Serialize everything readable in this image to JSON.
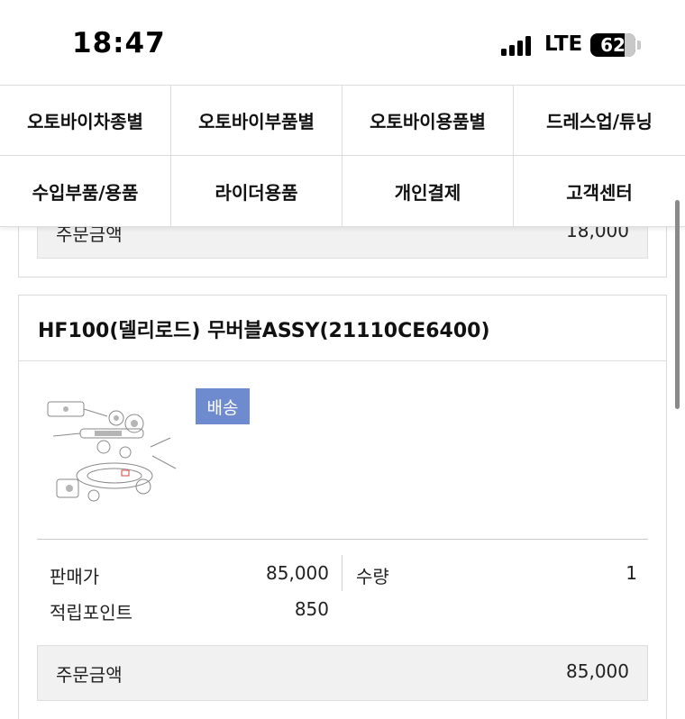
{
  "status_bar": {
    "time": "18:47",
    "network": "LTE",
    "battery": "62"
  },
  "menu": {
    "items": [
      "오토바이차종별",
      "오토바이부품별",
      "오토바이용품별",
      "드레스업/튜닝",
      "수입부품/용품",
      "라이더용품",
      "개인결제",
      "고객센터"
    ]
  },
  "prev_item": {
    "total_label": "주문금액",
    "total_value": "18,000"
  },
  "product": {
    "title": "HF100(델리로드) 무버블ASSY(21110CE6400)",
    "tag": "배송",
    "price_label": "판매가",
    "price_value": "85,000",
    "qty_label": "수량",
    "qty_value": "1",
    "points_label": "적립포인트",
    "points_value": "850",
    "total_label": "주문금액",
    "total_value": "85,000"
  },
  "colors": {
    "tag_bg": "#6f8bd0",
    "border": "#d9d9d9",
    "total_bg": "#f1f1f1"
  },
  "icons": [
    "signal-icon",
    "battery-icon",
    "parts-diagram-thumbnail"
  ]
}
